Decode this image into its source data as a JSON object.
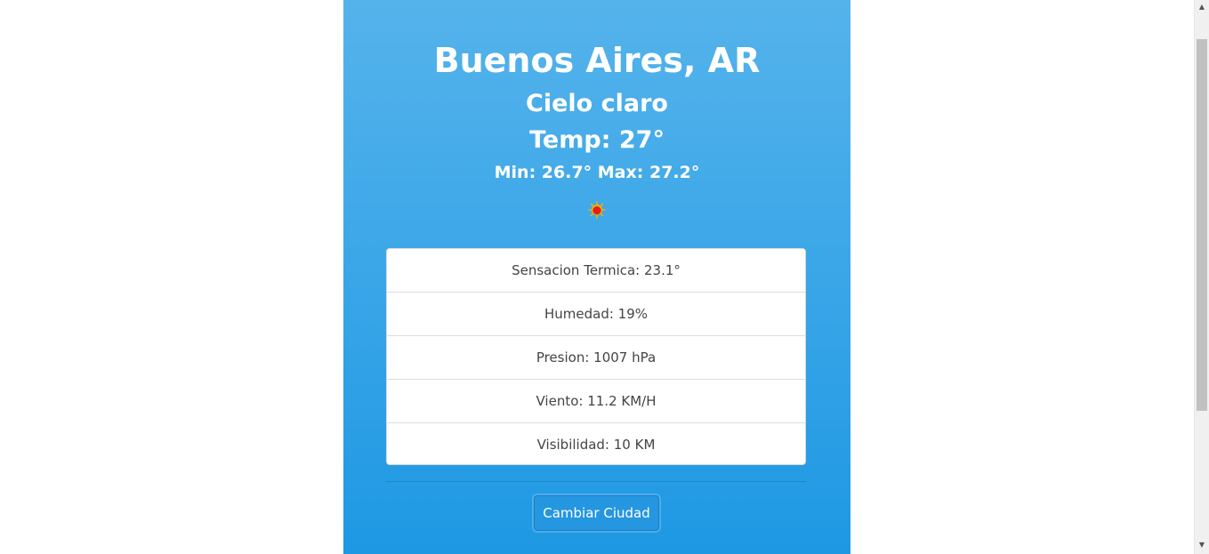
{
  "weather": {
    "city": "Buenos Aires, AR",
    "description": "Cielo claro",
    "temp": "Temp: 27°",
    "min_max": "Min: 26.7° Max: 27.2°",
    "icon": "sun-icon",
    "details": [
      {
        "label": "Sensacion Termica: 23.1°"
      },
      {
        "label": "Humedad: 19%"
      },
      {
        "label": "Presion: 1007 hPa"
      },
      {
        "label": "Viento: 11.2 KM/H"
      },
      {
        "label": "Visibilidad: 10 KM"
      }
    ],
    "change_city_label": "Cambiar Ciudad"
  },
  "colors": {
    "card_top": "#55b3eb",
    "card_bottom": "#1e98e3",
    "button": "#2596e0",
    "sun_outer": "#f2b000",
    "sun_inner": "#e81c1c"
  },
  "scrollbar": {
    "up_icon": "scroll-up-arrow-icon",
    "down_icon": "scroll-down-arrow-icon"
  }
}
